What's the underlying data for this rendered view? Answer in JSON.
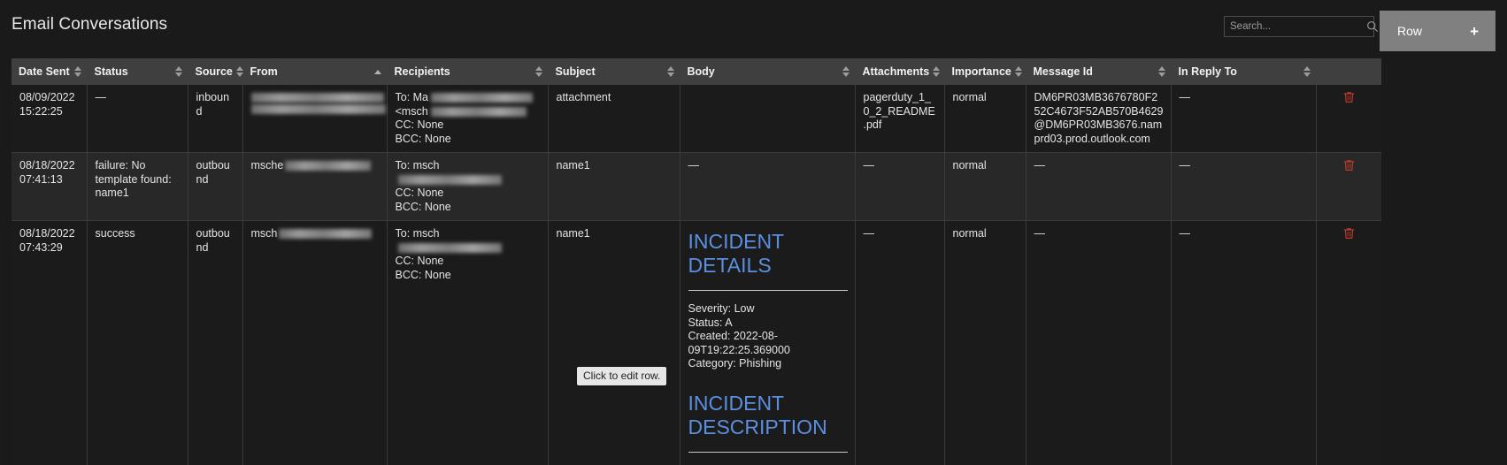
{
  "header": {
    "title": "Email Conversations",
    "search": {
      "placeholder": "Search...",
      "value": "",
      "icon": "search-icon"
    },
    "row_button": {
      "label": "Row",
      "plus": "+"
    }
  },
  "table": {
    "columns": [
      {
        "label": "Date Sent",
        "sort": "both"
      },
      {
        "label": "Status",
        "sort": "both"
      },
      {
        "label": "Source",
        "sort": "both"
      },
      {
        "label": "From",
        "sort": "asc"
      },
      {
        "label": "Recipients",
        "sort": "both"
      },
      {
        "label": "Subject",
        "sort": "both"
      },
      {
        "label": "Body",
        "sort": "both"
      },
      {
        "label": "Attachments",
        "sort": "both"
      },
      {
        "label": "Importance",
        "sort": "both"
      },
      {
        "label": "Message Id",
        "sort": "both"
      },
      {
        "label": "In Reply To",
        "sort": "both"
      }
    ],
    "rows": [
      {
        "date_sent": "08/09/2022 15:22:25",
        "status": "—",
        "source": "inbound",
        "from_prefix": "",
        "recipients_to": "To: Ma",
        "recipients_extra": "<msch",
        "recipients_cc": "CC: None",
        "recipients_bcc": "BCC: None",
        "subject": "attachment",
        "body": null,
        "attachments": "pagerduty_1_0_2_README.pdf",
        "importance": "normal",
        "message_id": "DM6PR03MB3676780F252C4673F52AB570B4629@DM6PR03MB3676.namprd03.prod.outlook.com",
        "in_reply_to": "—",
        "delete_icon": "trash-icon"
      },
      {
        "date_sent": "08/18/2022 07:41:13",
        "status": "failure: No template found: name1",
        "source": "outbound",
        "from_prefix": "msche",
        "recipients_to": "To: msch",
        "recipients_extra": "",
        "recipients_cc": "CC: None",
        "recipients_bcc": "BCC: None",
        "subject": "name1",
        "body": "—",
        "attachments": "—",
        "importance": "normal",
        "message_id": "—",
        "in_reply_to": "—",
        "delete_icon": "trash-icon"
      },
      {
        "date_sent": "08/18/2022 07:43:29",
        "status": "success",
        "source": "outbound",
        "from_prefix": "msch",
        "recipients_to": "To: msch",
        "recipients_extra": "",
        "recipients_cc": "CC: None",
        "recipients_bcc": "BCC: None",
        "subject": "name1",
        "body": {
          "heading1": "INCIDENT DETAILS",
          "severity": "Severity: Low",
          "status": "Status: A",
          "created": "Created: 2022-08-09T19:22:25.369000",
          "category": "Category: Phishing",
          "heading2": "INCIDENT DESCRIPTION"
        },
        "attachments": "—",
        "importance": "normal",
        "message_id": "—",
        "in_reply_to": "—",
        "delete_icon": "trash-icon"
      }
    ]
  },
  "tooltip": {
    "text": "Click to edit row."
  },
  "colors": {
    "background": "#1a1a1a",
    "header_row": "#3f3f3f",
    "row_dark": "#1b1b1b",
    "row_light": "#282828",
    "accent_button": "#808080",
    "link_heading": "#5b8fe0",
    "delete_icon": "#c0392b"
  }
}
